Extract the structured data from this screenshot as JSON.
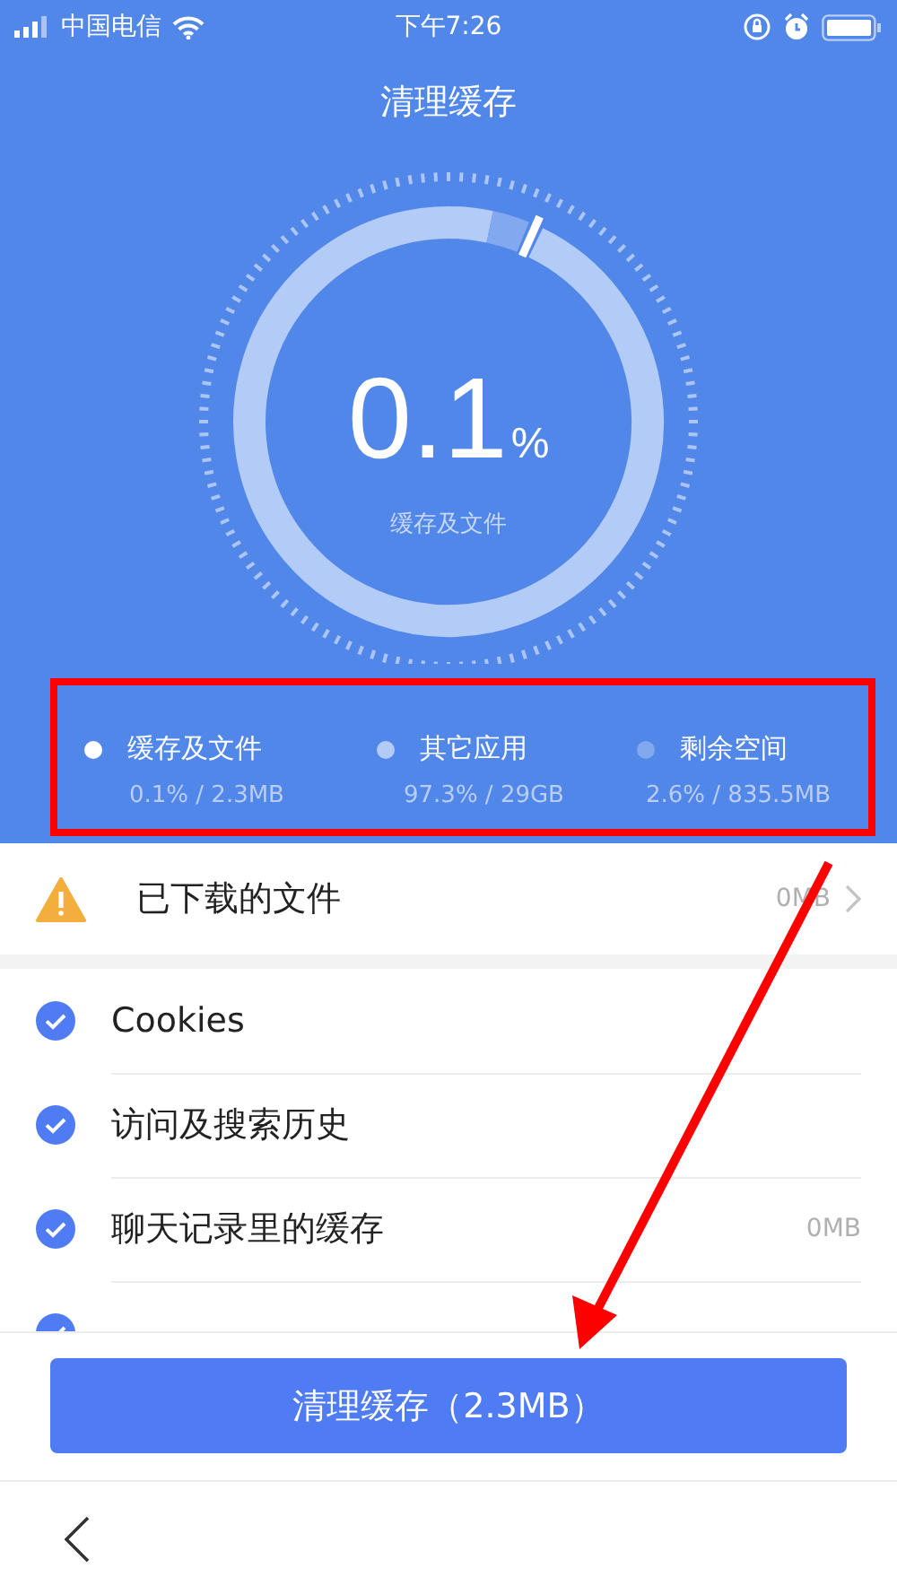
{
  "status_bar": {
    "carrier": "中国电信",
    "time": "下午7:26"
  },
  "header": {
    "title": "清理缓存"
  },
  "gauge": {
    "value": "0.1",
    "unit": "%",
    "caption": "缓存及文件"
  },
  "legend": [
    {
      "label": "缓存及文件",
      "detail": "0.1% / 2.3MB",
      "color": "#ffffff"
    },
    {
      "label": "其它应用",
      "detail": "97.3% / 29GB",
      "color": "#b3cbf7"
    },
    {
      "label": "剩余空间",
      "detail": "2.6% / 835.5MB",
      "color": "#82a8f0"
    }
  ],
  "downloads": {
    "label": "已下载的文件",
    "size": "0MB"
  },
  "items": [
    {
      "label": "Cookies",
      "checked": true
    },
    {
      "label": "访问及搜索历史",
      "checked": true
    },
    {
      "label": "聊天记录里的缓存",
      "size": "0MB",
      "checked": true
    },
    {
      "checked": true
    }
  ],
  "clean_button": {
    "label": "清理缓存（2.3MB）"
  }
}
